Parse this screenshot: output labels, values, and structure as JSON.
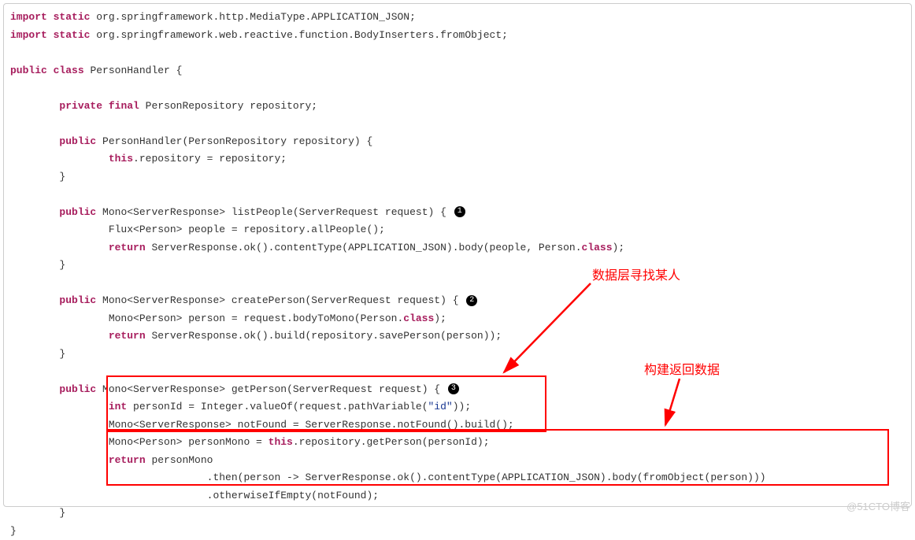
{
  "code": {
    "l1_kw1": "import",
    "l1_kw2": "static",
    "l1_rest": " org.springframework.http.MediaType.APPLICATION_JSON;",
    "l2_kw1": "import",
    "l2_kw2": "static",
    "l2_rest": " org.springframework.web.reactive.function.BodyInserters.fromObject;",
    "l4_kw1": "public",
    "l4_kw2": "class",
    "l4_rest": " PersonHandler {",
    "l6_kw1": "private",
    "l6_kw2": "final",
    "l6_rest": " PersonRepository repository;",
    "l8_kw1": "public",
    "l8_rest": " PersonHandler(PersonRepository repository) {",
    "l9_kw1": "this",
    "l9_rest": ".repository = repository;",
    "l10": "        }",
    "l12_kw1": "public",
    "l12_rest": " Mono<ServerResponse> listPeople(ServerRequest request) { ",
    "l13": "                Flux<Person> people = repository.allPeople();",
    "l14_kw1": "return",
    "l14_rest1": " ServerResponse.ok().contentType(APPLICATION_JSON).body(people, Person.",
    "l14_kw2": "class",
    "l14_rest2": ");",
    "l15": "        }",
    "l17_kw1": "public",
    "l17_rest": " Mono<ServerResponse> createPerson(ServerRequest request) { ",
    "l18_rest1": "                Mono<Person> person = request.bodyToMono(Person.",
    "l18_kw1": "class",
    "l18_rest2": ");",
    "l19_kw1": "return",
    "l19_rest": " ServerResponse.ok().build(repository.savePerson(person));",
    "l20": "        }",
    "l22_kw1": "public",
    "l22_rest": " Mono<ServerResponse> getPerson(ServerRequest request) { ",
    "l23_kw1": "int",
    "l23_rest1": " personId = Integer.valueOf(request.pathVariable(",
    "l23_str": "\"id\"",
    "l23_rest2": "));",
    "l24": "                Mono<ServerResponse> notFound = ServerResponse.notFound().build();",
    "l25_rest1": "                Mono<Person> personMono = ",
    "l25_kw1": "this",
    "l25_rest2": ".repository.getPerson(personId);",
    "l26_kw1": "return",
    "l26_rest": " personMono",
    "l27": "                                .then(person -> ServerResponse.ok().contentType(APPLICATION_JSON).body(fromObject(person)))",
    "l28": "                                .otherwiseIfEmpty(notFound);",
    "l29": "        }",
    "l30": "}"
  },
  "badge1": "1",
  "badge2": "2",
  "badge3": "3",
  "annotation1": "数据层寻找某人",
  "annotation2": "构建返回数据",
  "watermark": "@51CTO博客"
}
